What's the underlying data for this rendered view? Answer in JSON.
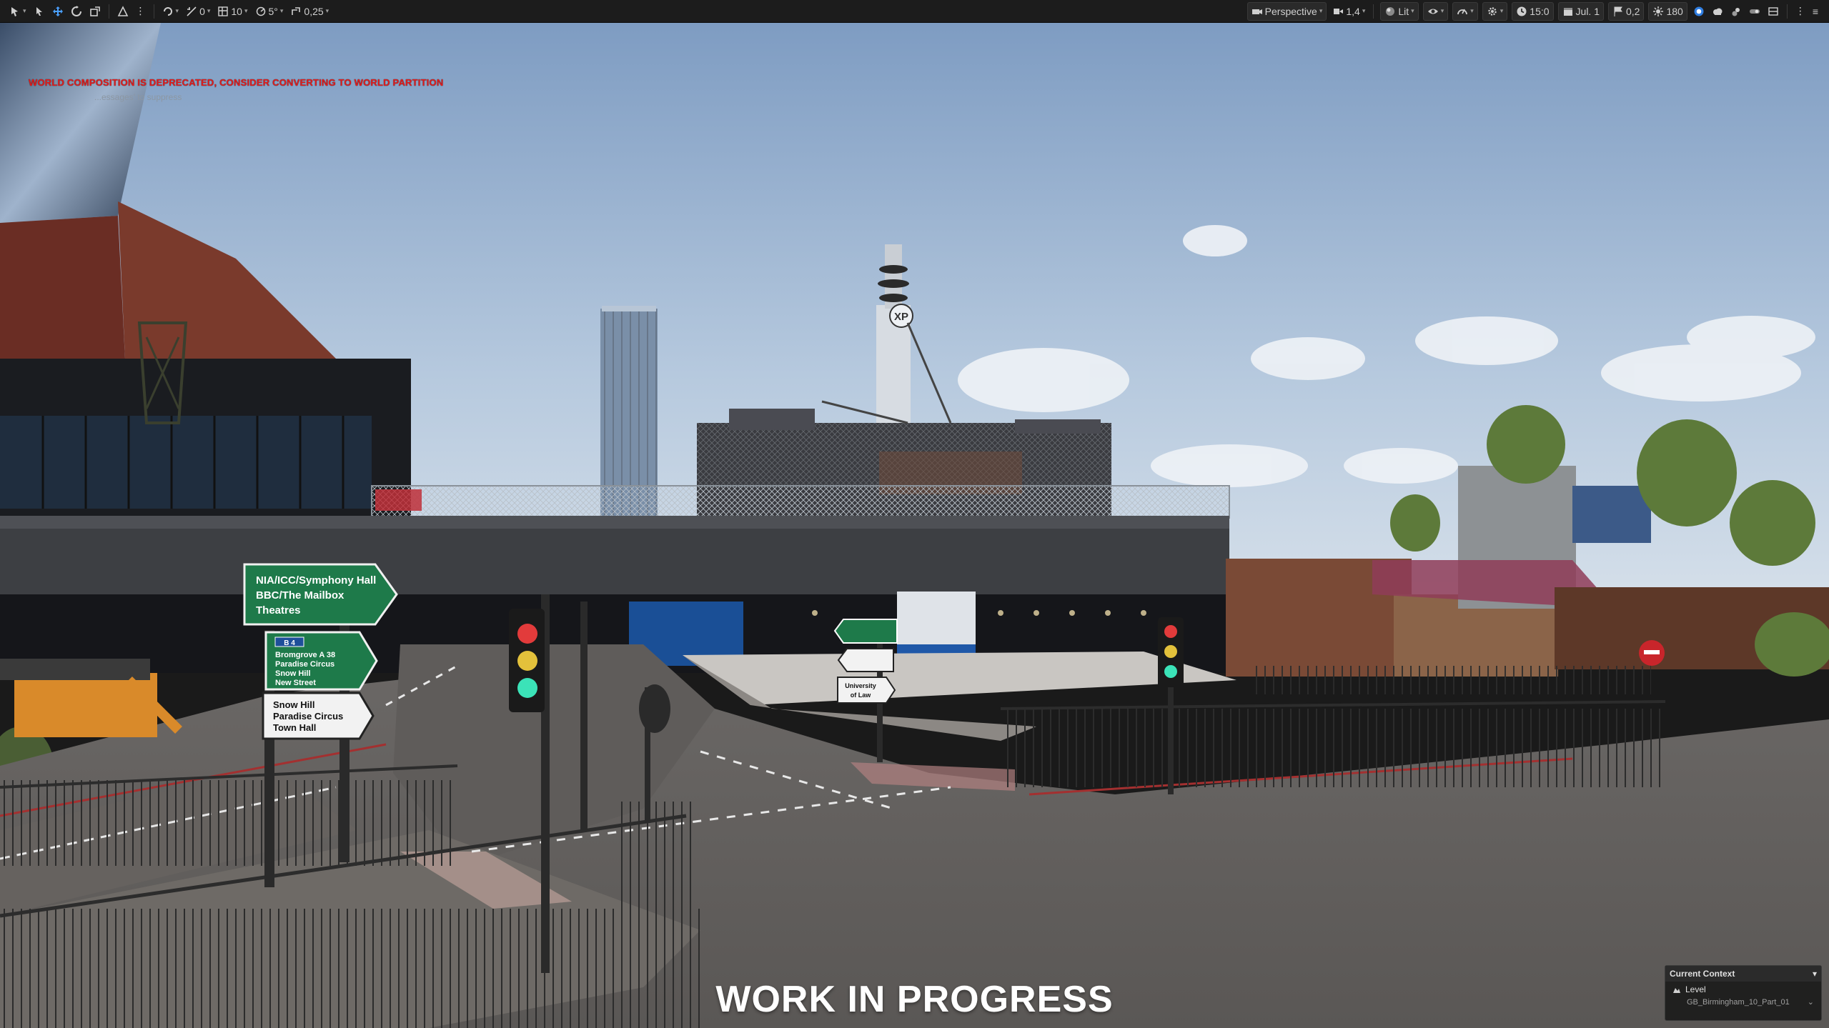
{
  "toolbar": {
    "left": {
      "translate_snap": "0",
      "grid_size": "10",
      "rotation_snap": "5°",
      "scale_snap": "0,25"
    },
    "right": {
      "view_mode": "Perspective",
      "camera_speed": "1,4",
      "lighting": "Lit",
      "time": "15:0",
      "date": "Jul. 1",
      "latitude": "0,2",
      "sun_value": "180"
    }
  },
  "viewport": {
    "warning": "WORLD COMPOSITION IS DEPRECATED, CONSIDER CONVERTING TO WORLD PARTITION",
    "warning_suppress": "...essages' to suppress",
    "watermark": "WORK IN PROGRESS",
    "signs": {
      "large_sign_lines": [
        "NIA/ICC/Symphony Hall",
        "BBC/The Mailbox",
        "Theatres"
      ],
      "mid_sign_badge": "B 4",
      "mid_sign_lines": [
        "Bromgrove A 38",
        "Paradise Circus",
        "Snow Hill",
        "New Street"
      ],
      "low_sign_lines": [
        "Snow Hill",
        "Paradise Circus",
        "Town Hall"
      ],
      "far_sign_lines": [
        "University",
        "of Law"
      ],
      "tower_logo": "XP"
    }
  },
  "context_panel": {
    "title": "Current Context",
    "level_label": "Level",
    "level_value": "GB_Birmingham_10_Part_01"
  },
  "colors": {
    "toolbar_bg": "#1c1c1c",
    "accent": "#4aa0ff",
    "warning": "#e31b1b",
    "sign_green": "#1e7a4a"
  }
}
